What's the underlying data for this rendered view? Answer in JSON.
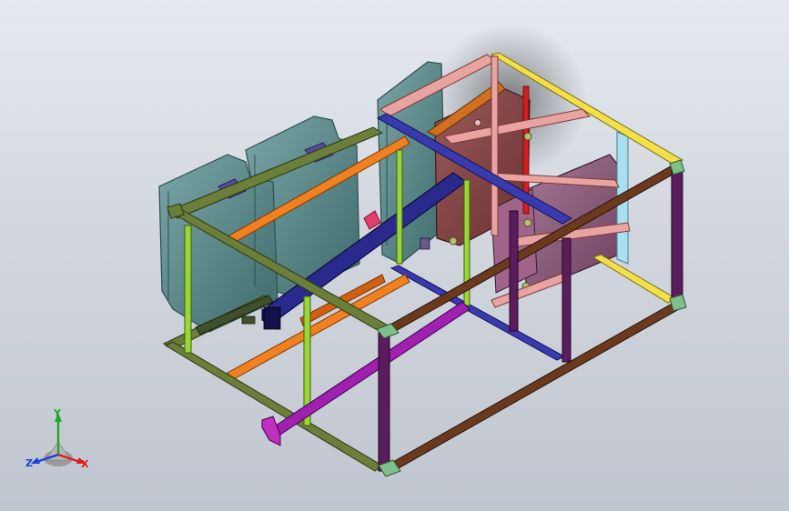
{
  "viewport": {
    "background_top": "#e6e9ef",
    "background_bottom": "#c0c6cf"
  },
  "model": {
    "frame_colors": {
      "front_green": "#6b7f3a",
      "lime_post": "#9ad634",
      "purple_post": "#5b1c5e",
      "brown_rail": "#6b3a1e",
      "yellow_rail": "#f2e04a",
      "pink_rail": "#e9a3a0",
      "orange_rail": "#f08020",
      "navy_beam": "#2a2a8c",
      "magenta_brace": "#a020b0",
      "blue_rail": "#3a3ab0",
      "mint_gusset": "#7fc08a"
    },
    "panel_colors": {
      "teal_panel": "#5d8a8c",
      "brown_plate": "#8a4a4a",
      "violet_plate": "#8a5a7a",
      "pink_plate": "#c77ab0"
    }
  },
  "triad": {
    "x_label": "X",
    "y_label": "Y",
    "z_label": "Z",
    "x_color": "#e01b1b",
    "y_color": "#1fa81f",
    "z_color": "#1b3fe0"
  }
}
